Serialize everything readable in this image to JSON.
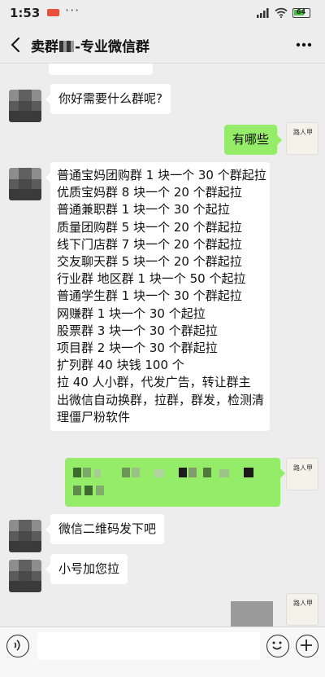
{
  "status_bar": {
    "time": "1:53",
    "notification_badge": "头条",
    "overflow": "···",
    "battery_level": "64"
  },
  "header": {
    "title_prefix": "卖群",
    "title_suffix": "-专业微信群",
    "back_icon": "chevron-left-icon",
    "more_icon": "ellipsis-icon"
  },
  "messages": [
    {
      "side": "left",
      "text": "你好需要什么群呢?"
    },
    {
      "side": "right",
      "text": "有哪些"
    },
    {
      "side": "left",
      "lines": [
        "普通宝妈团购群 1 块一个  30 个群起拉",
        "优质宝妈群 8 块一个 20 个群起拉",
        "普通兼职群 1 块一个  30 个起拉",
        "质量团购群 5 块一个  20 个群起拉",
        "线下门店群 7 块一个  20 个群起拉",
        "交友聊天群 5 块一个  20 个群起拉",
        "行业群 地区群 1 块一个 50 个起拉",
        "普通学生群 1 块一个  30 个群起拉",
        "网赚群 1 块一个 30 个起拉",
        "股票群 3 块一个  30 个群起拉",
        "项目群 2 块一个  30 个群起拉",
        "扩列群 40 块钱 100 个",
        "拉 40 人小群，代发广告，转让群主",
        "出微信自动换群，拉群，群发，检测清",
        "理僵尸粉软件"
      ]
    },
    {
      "side": "right",
      "text": ""
    },
    {
      "side": "left",
      "text": "微信二维码发下吧"
    },
    {
      "side": "left",
      "text": "小号加您拉"
    }
  ],
  "self_avatar_text": "路人甲",
  "input_bar": {
    "voice_icon": "voice-icon",
    "emoji_icon": "emoji-icon",
    "plus_icon": "plus-icon",
    "placeholder": ""
  },
  "colors": {
    "background": "#ededed",
    "bubble_self": "#95ec69",
    "bubble_other": "#ffffff"
  }
}
